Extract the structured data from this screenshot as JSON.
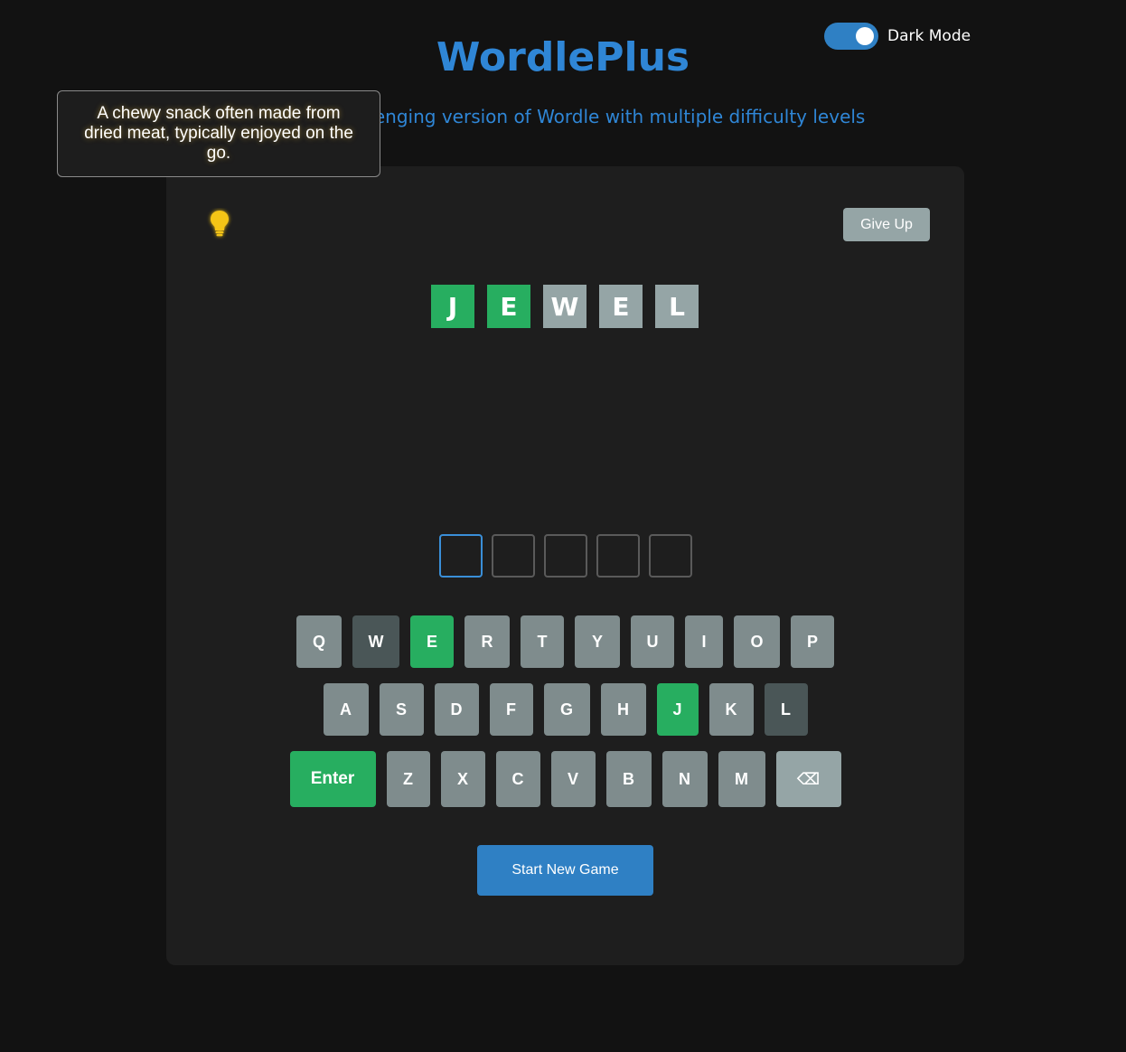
{
  "header": {
    "title": "WordlePlus",
    "subtitle": "A more challenging version of Wordle with multiple difficulty levels"
  },
  "dark_mode": {
    "label": "Dark Mode",
    "enabled": true
  },
  "hint": {
    "text": "A chewy snack often made from dried meat, typically enjoyed on the go.",
    "icon": "lightbulb-icon"
  },
  "toolbar": {
    "give_up_label": "Give Up"
  },
  "guesses": [
    {
      "tiles": [
        {
          "letter": "J",
          "status": "correct"
        },
        {
          "letter": "E",
          "status": "correct"
        },
        {
          "letter": "W",
          "status": "absent"
        },
        {
          "letter": "E",
          "status": "absent"
        },
        {
          "letter": "L",
          "status": "absent"
        }
      ]
    }
  ],
  "current_input": [
    "",
    "",
    "",
    "",
    ""
  ],
  "keyboard": {
    "rows": [
      [
        {
          "label": "Q",
          "status": "unused"
        },
        {
          "label": "W",
          "status": "absent"
        },
        {
          "label": "E",
          "status": "correct"
        },
        {
          "label": "R",
          "status": "unused"
        },
        {
          "label": "T",
          "status": "unused"
        },
        {
          "label": "Y",
          "status": "unused"
        },
        {
          "label": "U",
          "status": "unused"
        },
        {
          "label": "I",
          "status": "unused"
        },
        {
          "label": "O",
          "status": "unused"
        },
        {
          "label": "P",
          "status": "unused"
        }
      ],
      [
        {
          "label": "A",
          "status": "unused"
        },
        {
          "label": "S",
          "status": "unused"
        },
        {
          "label": "D",
          "status": "unused"
        },
        {
          "label": "F",
          "status": "unused"
        },
        {
          "label": "G",
          "status": "unused"
        },
        {
          "label": "H",
          "status": "unused"
        },
        {
          "label": "J",
          "status": "correct"
        },
        {
          "label": "K",
          "status": "unused"
        },
        {
          "label": "L",
          "status": "absent"
        }
      ],
      [
        {
          "label": "Enter",
          "status": "correct"
        },
        {
          "label": "Z",
          "status": "unused"
        },
        {
          "label": "X",
          "status": "unused"
        },
        {
          "label": "C",
          "status": "unused"
        },
        {
          "label": "V",
          "status": "unused"
        },
        {
          "label": "B",
          "status": "unused"
        },
        {
          "label": "N",
          "status": "unused"
        },
        {
          "label": "M",
          "status": "unused"
        },
        {
          "label": "⌫",
          "status": "back"
        }
      ]
    ]
  },
  "actions": {
    "start_new_label": "Start New Game"
  },
  "colors": {
    "accent": "#2f86d6",
    "correct": "#27ae60",
    "absent_tile": "#95a5a6",
    "absent_key": "#4a5657",
    "unused_key": "#7f8c8d"
  }
}
